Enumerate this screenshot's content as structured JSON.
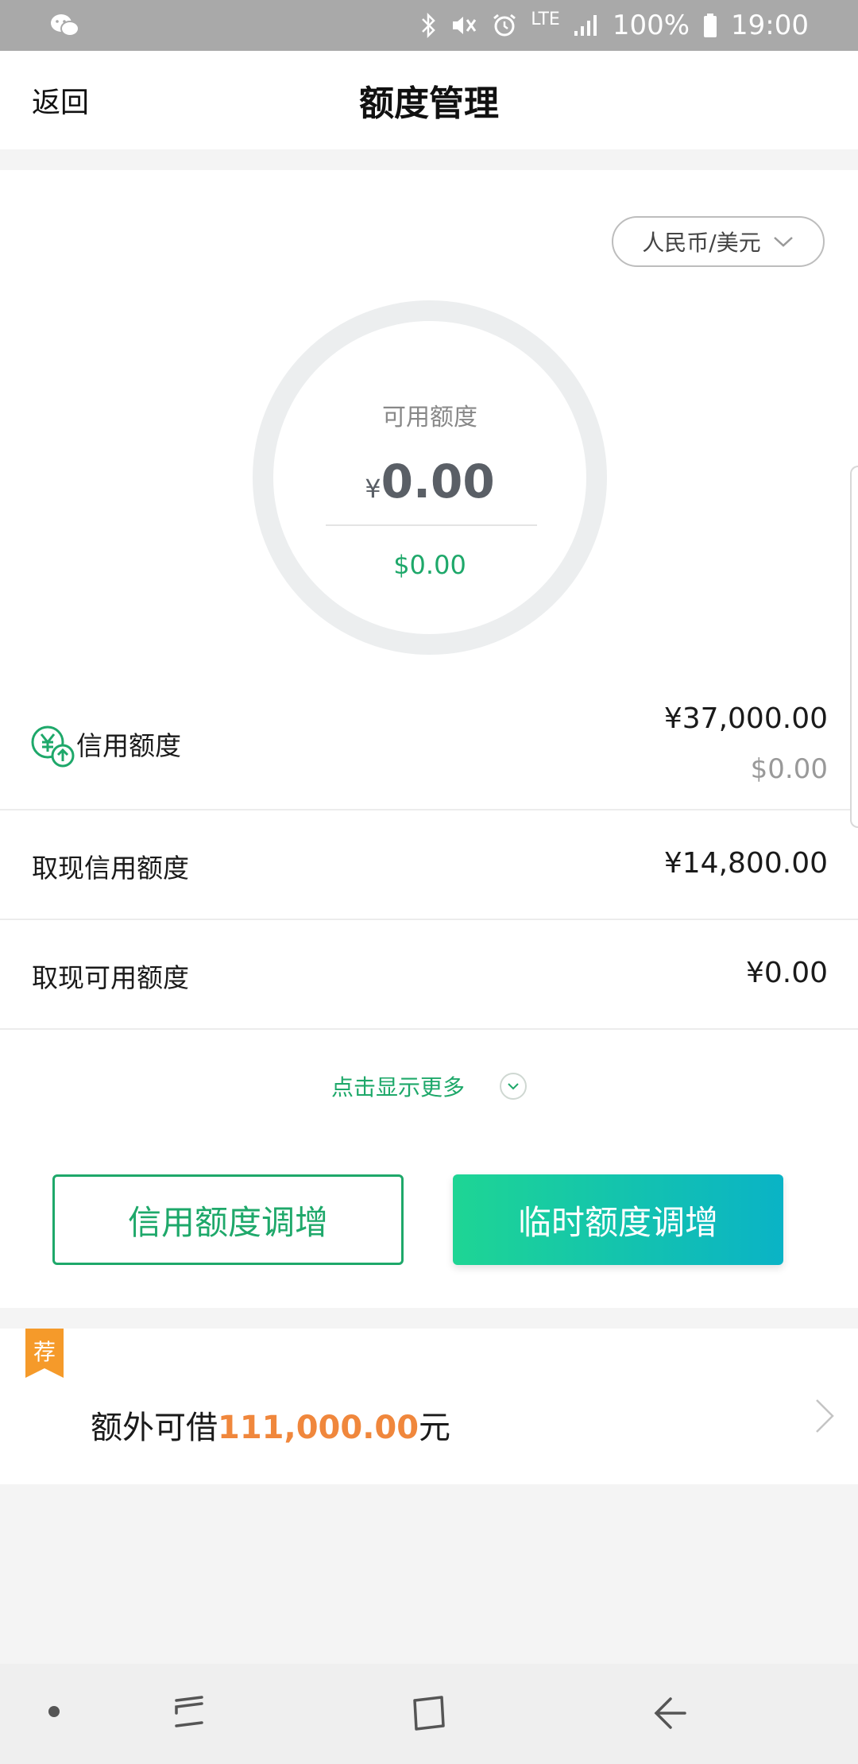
{
  "status_bar": {
    "left_icon": "wechat-icon",
    "network": "LTE",
    "battery": "100%",
    "time": "19:00",
    "icons": [
      "bluetooth-icon",
      "mute-icon",
      "alarm-icon",
      "signal-icon",
      "battery-icon"
    ]
  },
  "header": {
    "back_label": "返回",
    "title": "额度管理"
  },
  "currency_selector": {
    "label": "人民币/美元",
    "icon": "chevron-down-icon"
  },
  "available": {
    "label": "可用额度",
    "symbol": "¥",
    "amount": "0.00",
    "usd": "$0.00"
  },
  "rows": {
    "credit_limit": {
      "label": "信用额度",
      "value": "¥37,000.00",
      "sub_value": "$0.00",
      "icon": "credit-limit-icon"
    },
    "cash_credit_limit": {
      "label": "取现信用额度",
      "value": "¥14,800.00"
    },
    "cash_available_limit": {
      "label": "取现可用额度",
      "value": "¥0.00"
    }
  },
  "show_more": {
    "label": "点击显示更多"
  },
  "buttons": {
    "credit_increase": "信用额度调增",
    "temp_increase": "临时额度调增"
  },
  "promo": {
    "badge": "荐",
    "prefix": "额外可借",
    "amount": "111,000.00",
    "suffix": "元"
  },
  "colors": {
    "accent_green": "#1ea86a",
    "orange": "#f0873c",
    "gradient_start": "#1ed594",
    "gradient_end": "#0ab3c6"
  }
}
